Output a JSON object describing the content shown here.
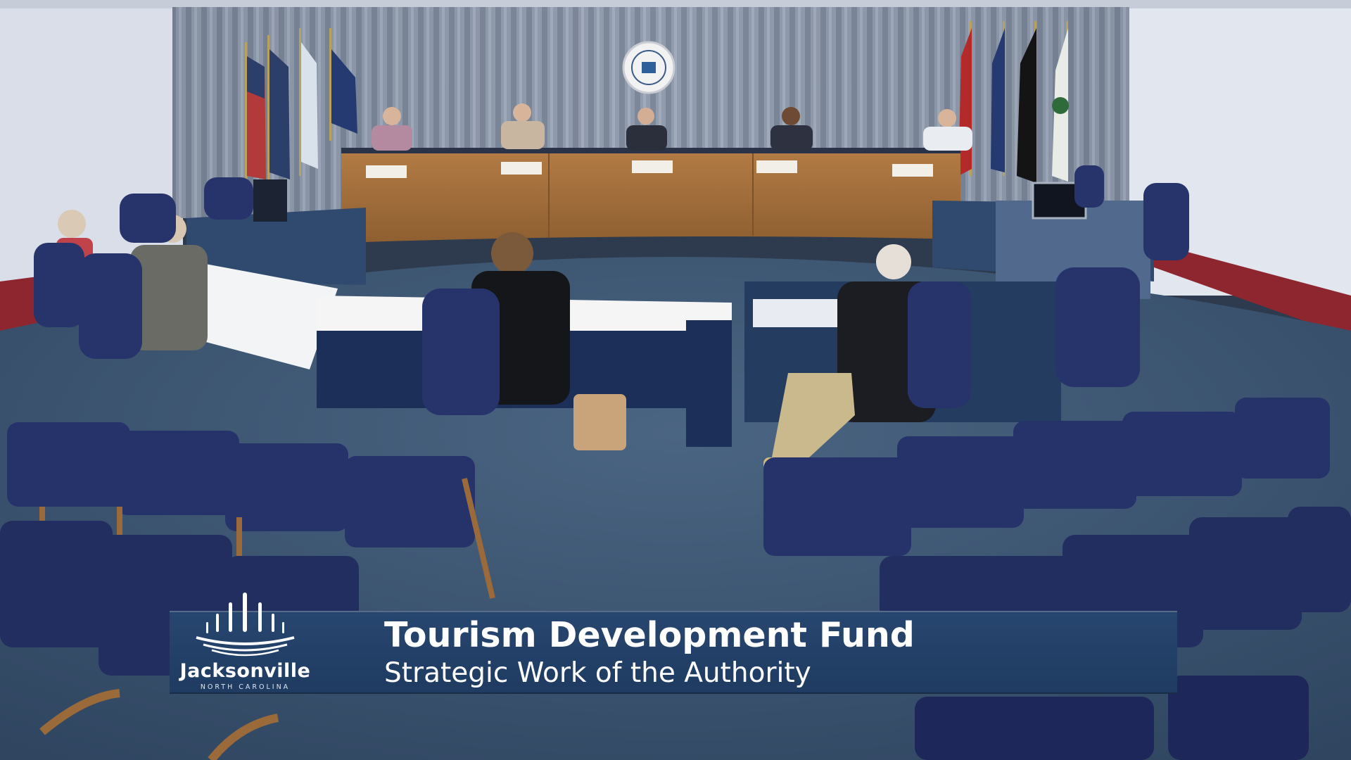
{
  "lower_third": {
    "title": "Tourism Development Fund",
    "subtitle": "Strategic Work of the Authority"
  },
  "logo": {
    "name": "Jacksonville",
    "tagline": "NORTH CAROLINA"
  },
  "colors": {
    "banner_blue": "#1f3b61",
    "carpet_blue": "#3f5a78",
    "curtain_gray": "#8a96a8",
    "dais_wood": "#a8733f",
    "chair_navy": "#27346b",
    "wall_white": "#e4e8ef"
  }
}
